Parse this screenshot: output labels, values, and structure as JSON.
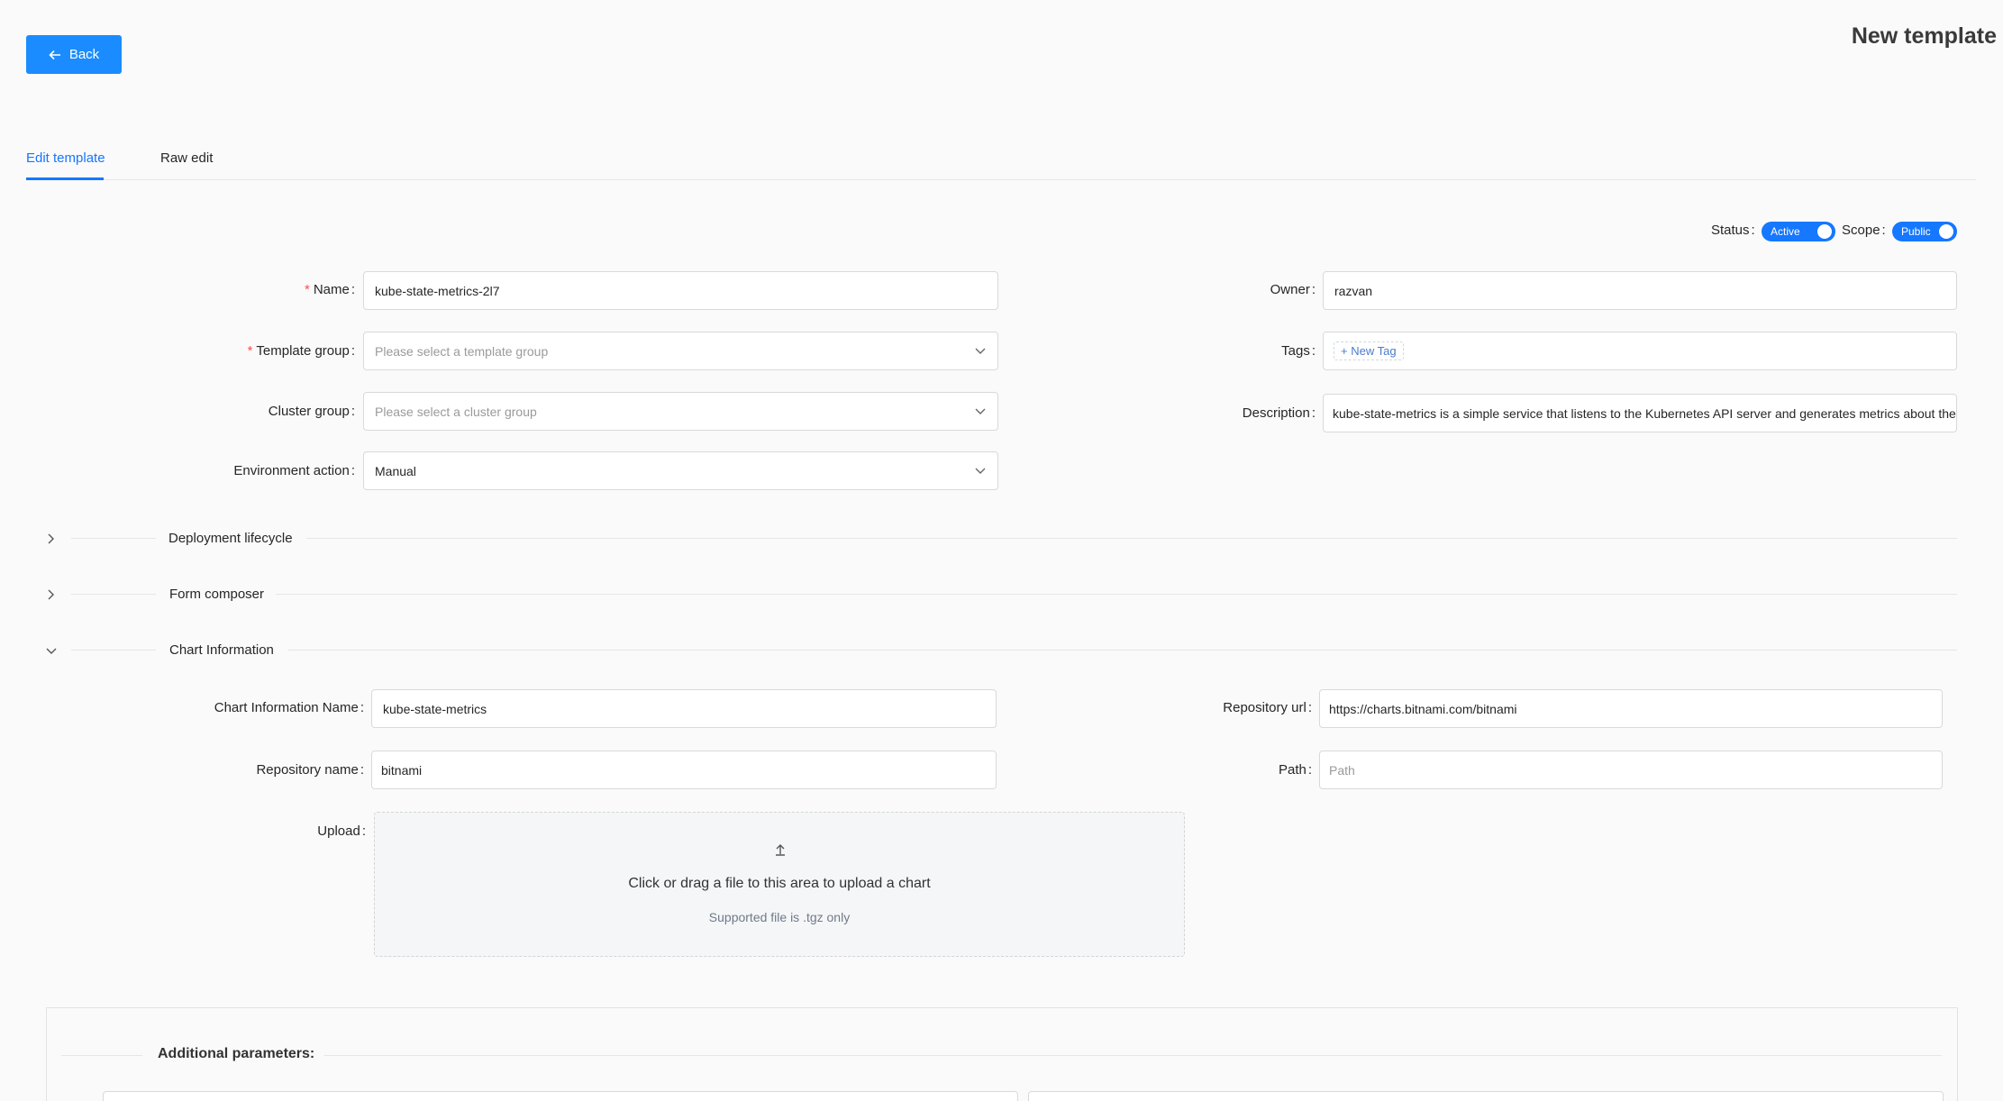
{
  "header": {
    "back_label": "Back",
    "title": "New template"
  },
  "tabs": [
    {
      "label": "Edit template",
      "active": true
    },
    {
      "label": "Raw edit",
      "active": false
    }
  ],
  "status": {
    "label": "Status",
    "value": "Active"
  },
  "scope": {
    "label": "Scope",
    "value": "Public"
  },
  "form": {
    "name": {
      "label": "Name",
      "value": "kube-state-metrics-2l7",
      "required": true
    },
    "template_group": {
      "label": "Template group",
      "placeholder": "Please select a template group",
      "required": true
    },
    "cluster_group": {
      "label": "Cluster group",
      "placeholder": "Please select a cluster group"
    },
    "environment_action": {
      "label": "Environment action",
      "value": "Manual"
    },
    "owner": {
      "label": "Owner",
      "value": "razvan"
    },
    "tags": {
      "label": "Tags",
      "new_tag_label": "New Tag"
    },
    "description": {
      "label": "Description",
      "value": "kube-state-metrics is a simple service that listens to the Kubernetes API server and generates metrics about the state of the objects."
    }
  },
  "sections": {
    "deployment_lifecycle": "Deployment lifecycle",
    "form_composer": "Form composer",
    "chart_information": "Chart Information"
  },
  "chart": {
    "name": {
      "label": "Chart Information Name",
      "value": "kube-state-metrics"
    },
    "repo_url": {
      "label": "Repository url",
      "value": "https://charts.bitnami.com/bitnami"
    },
    "repo_name": {
      "label": "Repository name",
      "value": "bitnami"
    },
    "path": {
      "label": "Path",
      "placeholder": "Path"
    },
    "upload": {
      "label": "Upload",
      "text": "Click or drag a file to this area to upload a chart",
      "hint": "Supported file is .tgz only"
    }
  },
  "additional": {
    "title": "Additional parameters:"
  },
  "colors": {
    "primary": "#1677ff",
    "required": "#ff4d4f"
  }
}
